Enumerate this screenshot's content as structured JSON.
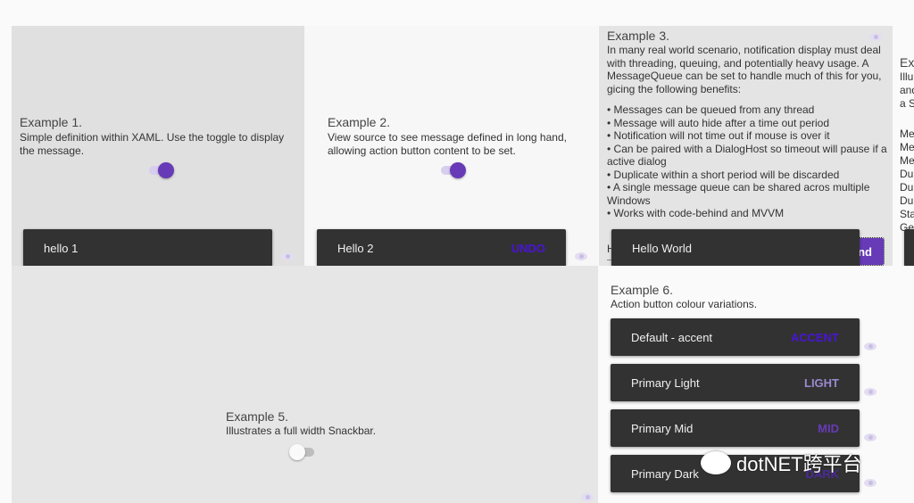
{
  "example1": {
    "title": "Example 1.",
    "description": "Simple definition within XAML. Use the toggle to display the message.",
    "toggle_on": true,
    "snackbar_message": "hello 1"
  },
  "example2": {
    "title": "Example 2.",
    "description": "View source to see message defined in long hand, allowing action button content to be set.",
    "toggle_on": true,
    "snackbar_message": "Hello 2",
    "action": "UNDO"
  },
  "example3": {
    "title": "Example 3.",
    "description": "In many real world scenario, notification display must deal with threading, queuing, and potentially heavy usage. A MessageQueue can be set to handle much of this for you, gicing the following benefits:",
    "benefits": [
      "• Messages can be queued from any thread",
      "• Message will auto hide after a time out period",
      "• Notification will not time out if mouse is over it",
      "• Can be paired with a DialogHost so timeout will pause if a active dialog",
      "• Duplicate within a short period will be discarded",
      "• A single message queue can be shared acros multiple Windows",
      "• Works with code-behind and MVVM"
    ],
    "input_partial": "H",
    "snackbar_message": "Hello World",
    "send_button_partial": "nd"
  },
  "example4": {
    "title_partial": "Ex",
    "desc_partial": [
      "Illu",
      "and",
      "a S"
    ],
    "lines_partial": [
      "Me",
      "Me",
      "Me",
      "Du",
      "Du",
      "Du",
      "Sta",
      "Ge"
    ]
  },
  "example5": {
    "title": "Example 5.",
    "description": "Illustrates a full width Snackbar.",
    "toggle_on": false
  },
  "example6": {
    "title": "Example 6.",
    "description": "Action button colour variations.",
    "snackbars": [
      {
        "message": "Default - accent",
        "action": "ACCENT",
        "color": "#4a14d6"
      },
      {
        "message": "Primary Light",
        "action": "LIGHT",
        "color": "#9a8ad0"
      },
      {
        "message": "Primary Mid",
        "action": "MID",
        "color": "#673ab7"
      },
      {
        "message": "Primary Dark",
        "action": "DARK",
        "color": "#4a2a9a"
      }
    ]
  },
  "watermark": "dotNET跨平台",
  "colors": {
    "primary": "#673ab7",
    "snackbar": "#323232"
  }
}
